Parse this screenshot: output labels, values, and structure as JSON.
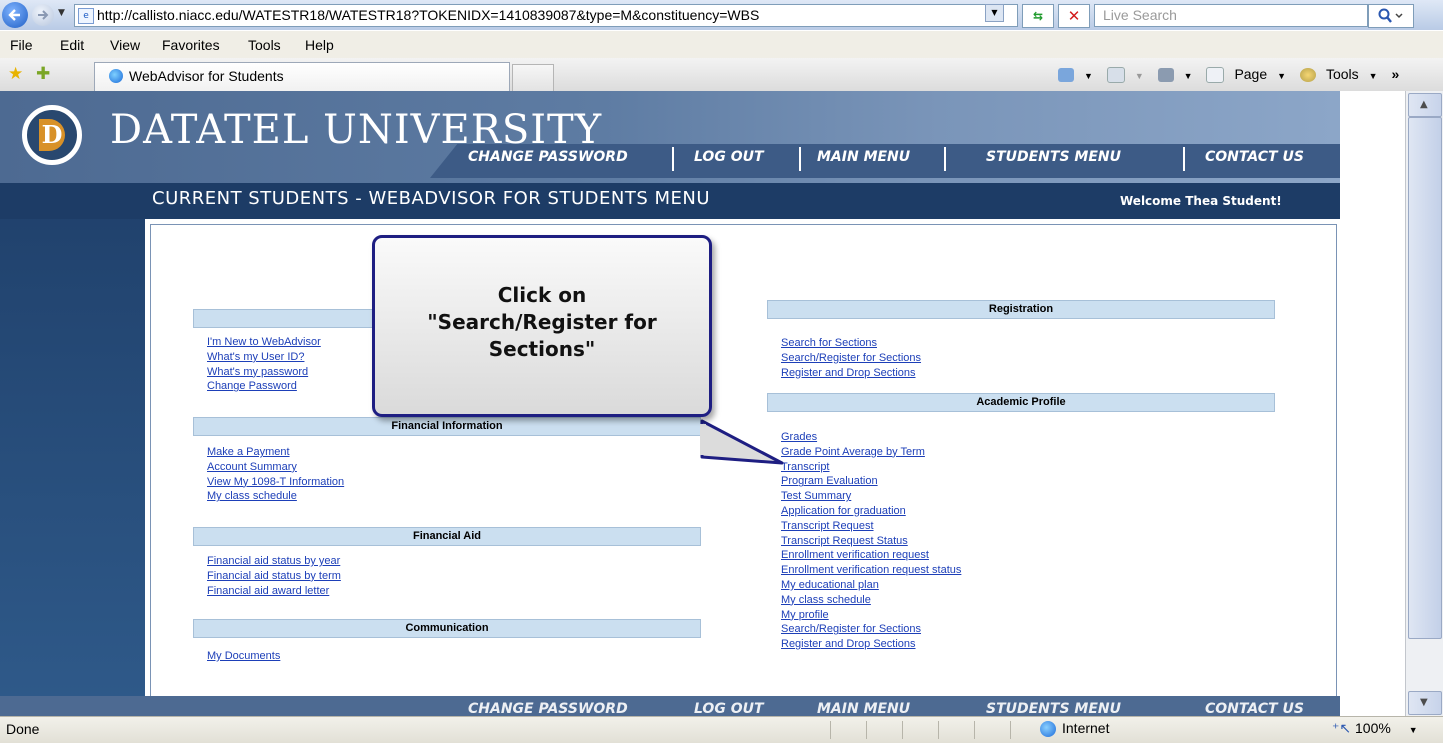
{
  "browser": {
    "url": "http://callisto.niacc.edu/WATESTR18/WATESTR18?TOKENIDX=1410839087&type=M&constituency=WBS",
    "search_placeholder": "Live Search",
    "menus": [
      "File",
      "Edit",
      "View",
      "Favorites",
      "Tools",
      "Help"
    ],
    "tab_title": "WebAdvisor for Students",
    "command_bar": {
      "page": "Page",
      "tools": "Tools"
    },
    "status": "Done",
    "zone": "Internet",
    "zoom": "100%"
  },
  "site": {
    "university": "DATATEL UNIVERSITY",
    "logo_letter": "D",
    "nav": [
      "CHANGE PASSWORD",
      "LOG OUT",
      "MAIN MENU",
      "STUDENTS MENU",
      "CONTACT US"
    ],
    "page_title": "CURRENT STUDENTS - WEBADVISOR FOR STUDENTS MENU",
    "welcome": "Welcome Thea Student!"
  },
  "left_sections": [
    {
      "title": "",
      "links": [
        "I'm New to WebAdvisor",
        "What's my User ID?",
        "What's my password",
        "Change Password"
      ]
    },
    {
      "title": "Financial Information",
      "links": [
        "Make a Payment",
        "Account Summary",
        "View My 1098-T Information",
        "My class schedule"
      ]
    },
    {
      "title": "Financial Aid",
      "links": [
        "Financial aid status by year",
        "Financial aid status by term",
        "Financial aid award letter"
      ]
    },
    {
      "title": "Communication",
      "links": [
        "My Documents"
      ]
    }
  ],
  "right_sections": [
    {
      "title": "Registration",
      "links": [
        "Search for Sections",
        "Search/Register for Sections",
        "Register and Drop Sections"
      ]
    },
    {
      "title": "Academic Profile",
      "links": [
        "Grades",
        "Grade Point Average by Term",
        "Transcript",
        "Program Evaluation",
        "Test Summary",
        "Application for graduation",
        "Transcript Request",
        "Transcript Request Status",
        "Enrollment verification request",
        "Enrollment verification request status",
        "My educational plan",
        "My class schedule",
        "My profile",
        "Search/Register for Sections",
        "Register and Drop Sections"
      ]
    }
  ],
  "callout": {
    "line1": "Click on",
    "line2": "\"Search/Register for",
    "line3": "Sections\""
  }
}
